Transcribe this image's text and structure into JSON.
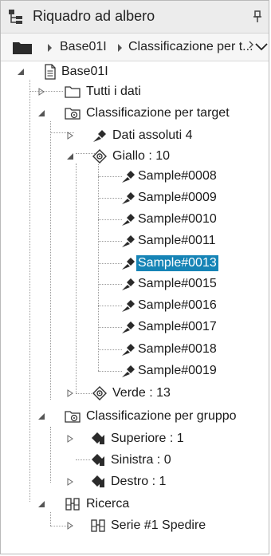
{
  "titlebar": {
    "title": "Riquadro ad albero"
  },
  "breadcrumb": {
    "item1": "Base01I",
    "item2": "Classificazione per t..."
  },
  "tree": {
    "root": {
      "label": "Base01I"
    },
    "all_data": {
      "label": "Tutti i dati"
    },
    "class_target": {
      "label": "Classificazione per target"
    },
    "dati_assoluti": {
      "label": "Dati assoluti 4"
    },
    "giallo": {
      "label": "Giallo : 10"
    },
    "samples": [
      {
        "label": "Sample#0008"
      },
      {
        "label": "Sample#0009"
      },
      {
        "label": "Sample#0010"
      },
      {
        "label": "Sample#0011"
      },
      {
        "label": "Sample#0013",
        "selected": true
      },
      {
        "label": "Sample#0015"
      },
      {
        "label": "Sample#0016"
      },
      {
        "label": "Sample#0017"
      },
      {
        "label": "Sample#0018"
      },
      {
        "label": "Sample#0019"
      }
    ],
    "verde": {
      "label": "Verde : 13"
    },
    "class_gruppo": {
      "label": "Classificazione per gruppo"
    },
    "superiore": {
      "label": "Superiore : 1"
    },
    "sinistra": {
      "label": "Sinistra : 0"
    },
    "destro": {
      "label": "Destro : 1"
    },
    "ricerca": {
      "label": "Ricerca"
    },
    "serie": {
      "label": "Serie #1 Spedire"
    }
  },
  "colors": {
    "selection": "#1684b6",
    "selection_text": "#ffffff"
  }
}
